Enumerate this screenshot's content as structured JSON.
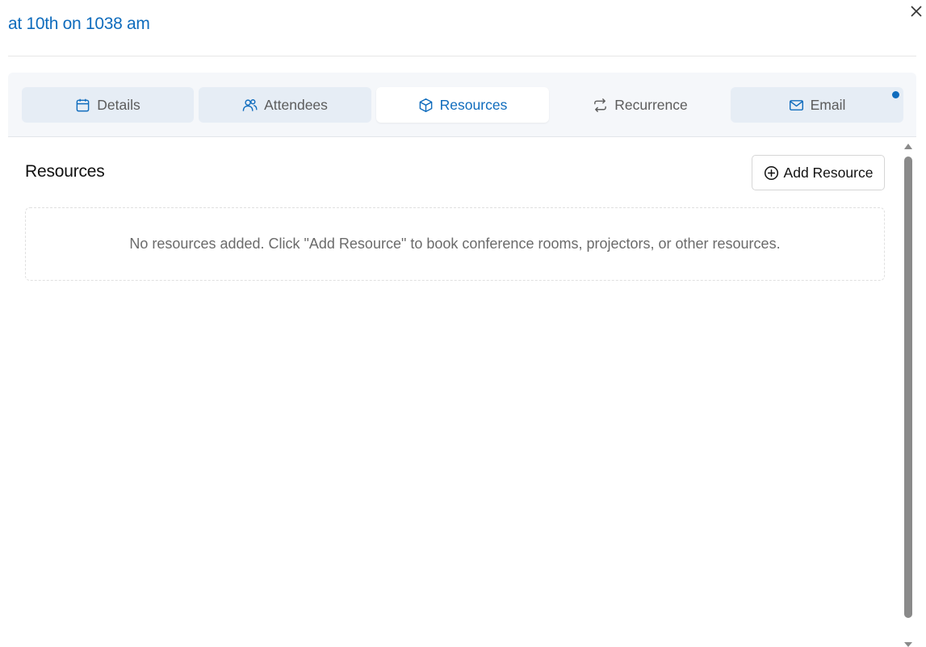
{
  "dialog": {
    "title": "at 10th on 1038 am",
    "close_icon": "close-icon"
  },
  "tabs": [
    {
      "label": "Details",
      "icon": "calendar-icon",
      "state": "inactive"
    },
    {
      "label": "Attendees",
      "icon": "people-icon",
      "state": "inactive"
    },
    {
      "label": "Resources",
      "icon": "cube-icon",
      "state": "active"
    },
    {
      "label": "Recurrence",
      "icon": "repeat-icon",
      "state": "plain"
    },
    {
      "label": "Email",
      "icon": "mail-icon",
      "state": "inactive",
      "has_notification_dot": true
    }
  ],
  "resources": {
    "heading": "Resources",
    "add_button_label": "Add Resource",
    "add_button_icon": "plus-circle-icon",
    "empty_message": "No resources added. Click \"Add Resource\" to book conference rooms, projectors, or other resources."
  },
  "colors": {
    "accent": "#0f6cbd",
    "tab_inactive_bg": "#e6edf5",
    "tabbar_bg": "#f5f7fa",
    "scrollbar": "#8a8a8a"
  }
}
